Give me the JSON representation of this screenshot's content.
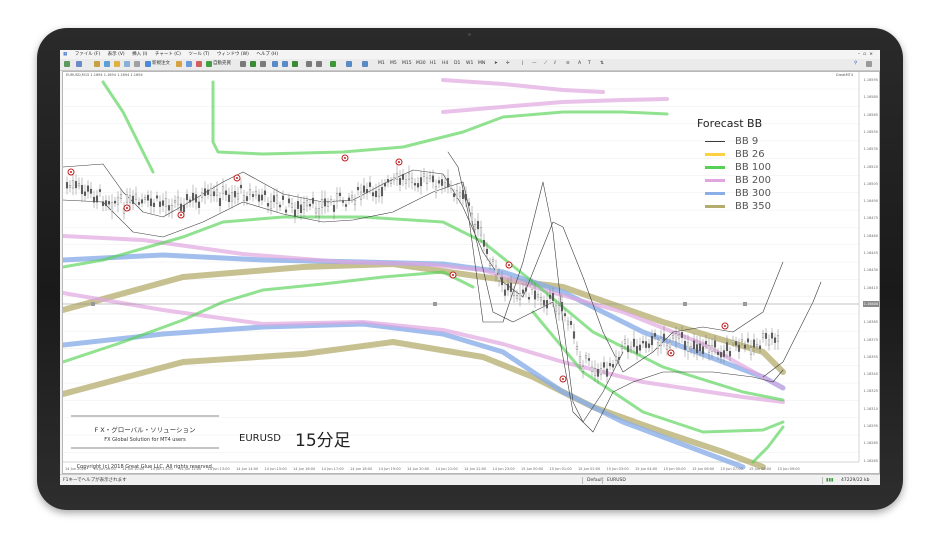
{
  "menu": [
    "ファイル (F)",
    "表示 (V)",
    "挿入 (I)",
    "チャート (C)",
    "ツール (T)",
    "ウィンドウ (W)",
    "ヘルプ (H)"
  ],
  "toolbar": {
    "new_order": "新規注文",
    "auto_trade": "自動売買",
    "timeframes": [
      "M1",
      "M5",
      "M15",
      "M30",
      "H1",
      "H4",
      "D1",
      "W1",
      "MN"
    ]
  },
  "chart_header": "EURUSD,M15 1.1694 1.1694 1.1694 1.1694",
  "indicator_header": "GreatMT4",
  "legend": {
    "title": "Forecast BB",
    "items": [
      {
        "label": "BB 9",
        "color": "#3c3c3c"
      },
      {
        "label": "BB 26",
        "color": "#ffd040"
      },
      {
        "label": "BB 100",
        "color": "#55d255"
      },
      {
        "label": "BB 200",
        "color": "#e0a6e0"
      },
      {
        "label": "BB 300",
        "color": "#8aaee8"
      },
      {
        "label": "BB 350",
        "color": "#b4ac6c"
      }
    ]
  },
  "branding": {
    "jp": "F X・グローバル・ソリューション",
    "en": "FX Global Solution for MT4 users",
    "copyright": "Copyright (c) 2018  Great Glue LLC.  All rights reserved."
  },
  "pair_label": "EURUSD",
  "timeframe_label": "15分足",
  "price_labels": [
    "1.16595",
    "1.16580",
    "1.16565",
    "1.16550",
    "1.16535",
    "1.16520",
    "1.16505",
    "1.16490",
    "1.16475",
    "1.16460",
    "1.16445",
    "1.16430",
    "1.16415",
    "1.16400",
    "1.16385",
    "1.16370",
    "1.16355",
    "1.16340",
    "1.16325",
    "1.16310",
    "1.16295",
    "1.16280",
    "1.16265"
  ],
  "current_price": "1.16400",
  "time_labels": [
    "14 Jun 2018",
    "14 Jun 09:00",
    "14 Jun 10:00",
    "14 Jun 11:00",
    "14 Jun 12:00",
    "14 Jun 13:00",
    "14 Jun 14:00",
    "14 Jun 15:00",
    "14 Jun 16:00",
    "14 Jun 17:00",
    "14 Jun 18:00",
    "14 Jun 19:00",
    "14 Jun 20:00",
    "14 Jun 21:00",
    "14 Jun 22:00",
    "14 Jun 23:00",
    "15 Jun 00:00",
    "15 Jun 01:00",
    "15 Jun 02:00",
    "15 Jun 03:00",
    "15 Jun 04:00",
    "15 Jun 05:00",
    "15 Jun 06:00",
    "15 Jun 07:00",
    "15 Jun 08:00",
    "15 Jun 09:00"
  ],
  "status": {
    "help": "F1キーでヘルプが表示されます",
    "profile": "Default",
    "pair": "EURUSD",
    "traffic": "47229/22 kb"
  }
}
